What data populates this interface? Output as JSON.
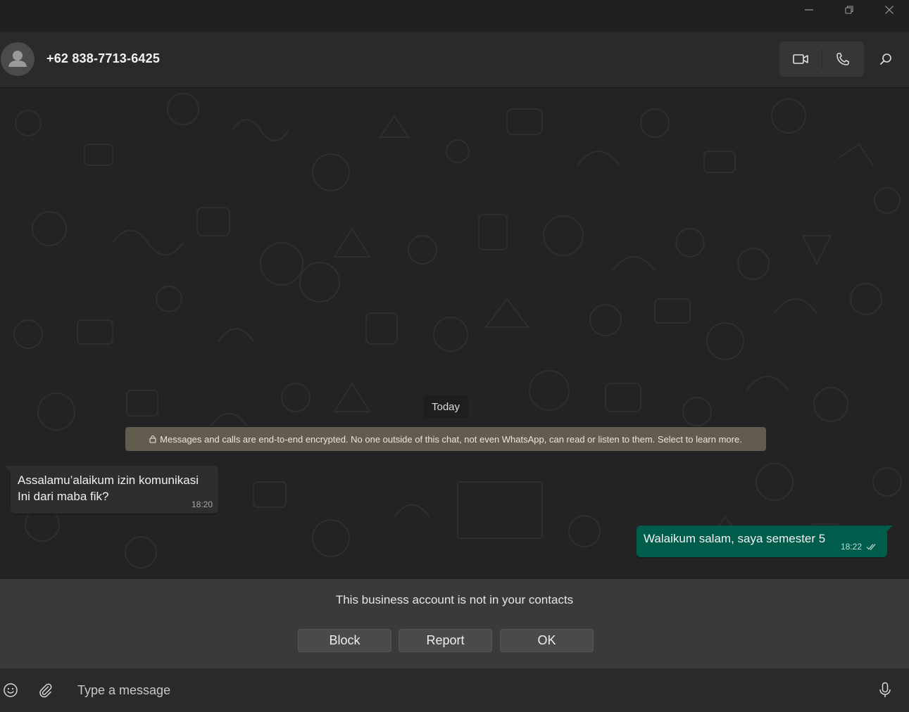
{
  "window": {
    "minimize_icon": "minimize-icon",
    "restore_icon": "restore-icon",
    "close_icon": "close-icon"
  },
  "header": {
    "contact_name": "+62 838-7713-6425",
    "avatar_icon": "default-avatar-icon",
    "video_call_icon": "video-call-icon",
    "voice_call_icon": "voice-call-icon",
    "search_icon": "search-icon"
  },
  "chat": {
    "date_separator": "Today",
    "encryption_notice": "Messages and calls are end-to-end encrypted. No one outside of this chat, not even WhatsApp, can read or listen to them. Select to learn more.",
    "messages": [
      {
        "direction": "incoming",
        "text": "Assalamu’alaikum izin komunikasi\nIni dari maba fik?",
        "time": "18:20"
      },
      {
        "direction": "outgoing",
        "text": "Walaikum salam, saya semester 5",
        "time": "18:22",
        "status": "read"
      }
    ]
  },
  "business_notice": {
    "text": "This business account is not in your contacts",
    "buttons": {
      "block": "Block",
      "report": "Report",
      "ok": "OK"
    }
  },
  "composer": {
    "placeholder": "Type a message",
    "emoji_icon": "emoji-icon",
    "attach_icon": "paperclip-icon",
    "mic_icon": "microphone-icon"
  },
  "colors": {
    "outgoing_bubble": "#005c4b",
    "incoming_bubble": "#2e2e2e",
    "encryption_notice_bg": "#625c4f",
    "chat_bg": "#232323"
  }
}
